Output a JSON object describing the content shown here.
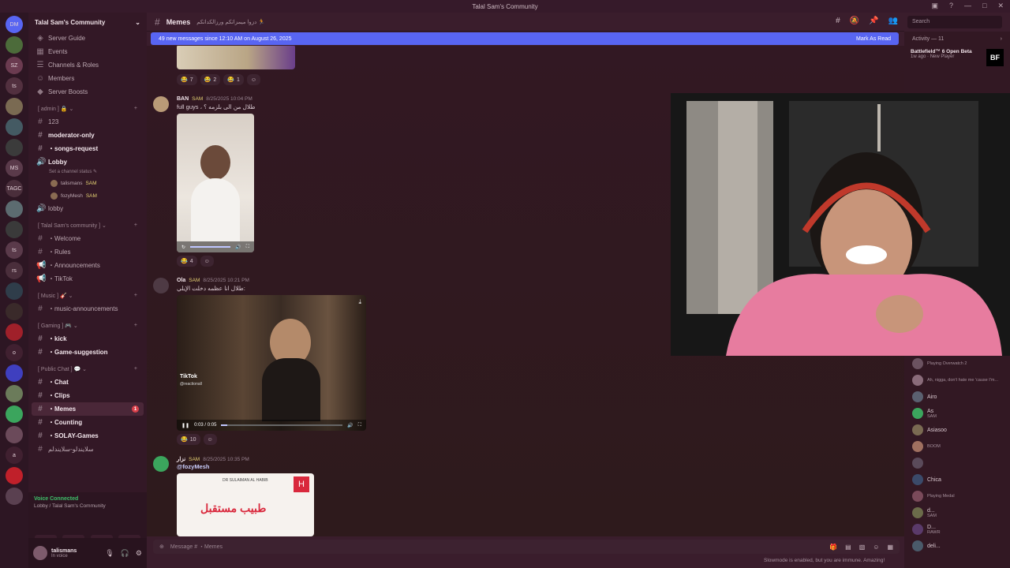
{
  "titlebar": {
    "title": "Talal Sam's Community"
  },
  "rail": {
    "servers": [
      "DM",
      "",
      "SZ",
      "ts",
      "",
      "",
      "",
      "MS",
      "TAGC",
      "",
      "",
      "ts",
      "rs",
      "",
      "",
      "",
      "o",
      "",
      "",
      "",
      "",
      "a",
      "",
      ""
    ]
  },
  "sidebar": {
    "server_name": "Talal Sam's Community",
    "top_items": [
      {
        "label": "Server Guide",
        "icon": "guide-icon"
      },
      {
        "label": "Events",
        "icon": "calendar-icon"
      },
      {
        "label": "Channels & Roles",
        "icon": "list-icon"
      },
      {
        "label": "Members",
        "icon": "people-icon"
      },
      {
        "label": "Server Boosts",
        "icon": "boost-icon"
      }
    ],
    "cat_admin": "[ admin ] 🔒 ⌄",
    "admin_channels": [
      "123",
      "moderator-only",
      "・songs-request"
    ],
    "lobby": "Lobby",
    "lobby_status": "Set a channel status ✎",
    "lobby_users": [
      {
        "name": "talismans",
        "tag": "SAM"
      },
      {
        "name": "fozyMesh",
        "tag": "SAM"
      }
    ],
    "lobby_text": "lobby",
    "cat_community": "[ Talal Sam's community ] ⌄",
    "community_channels": [
      "・Welcome",
      "・Rules",
      "・Announcements",
      "・TikTok"
    ],
    "cat_music": "[ Music ] 🎸 ⌄",
    "music_channels": [
      "・music-announcements"
    ],
    "cat_gaming": "[ Gaming ] 🎮 ⌄",
    "gaming_channels": [
      "・kick",
      "・Game-suggestion"
    ],
    "cat_public": "[ Public Chat ] 💬 ⌄",
    "public_channels": [
      "・Chat",
      "・Clips",
      "・Memes",
      "・Counting",
      "・SOLAY-Games",
      "سلايندلو-سلايندلم"
    ],
    "chat_badge": "",
    "memes_badge": "1",
    "voice_connected": "Voice Connected",
    "voice_sub": "Lobby / Talal Sam's Community",
    "user_name": "talismans",
    "user_status": "In voice"
  },
  "header": {
    "channel": "Memes",
    "topic": "دزوا ميمزاتكم ورزالكداتكم 🏃"
  },
  "search": {
    "placeholder": "Search"
  },
  "banner": {
    "text": "49 new messages since 12:10 AM on August 26, 2025",
    "action": "Mark As Read"
  },
  "messages": [
    {
      "reactions": [
        {
          "e": "😂",
          "n": "7"
        },
        {
          "e": "😂",
          "n": "2"
        },
        {
          "e": "😂",
          "n": "1"
        }
      ]
    },
    {
      "user": "BAN",
      "tag": "SAM",
      "time": "8/25/2025 10:04 PM",
      "text": "full guys ، طلال من الى بلزمه ؟",
      "reactions": [
        {
          "e": "😂",
          "n": "4"
        }
      ]
    },
    {
      "user": "Ola",
      "tag": "SAM",
      "time": "8/25/2025 10:21 PM",
      "text": "طلال انا عظمه دخلت الإيلي:",
      "video_time": "0:03 / 0:05",
      "progress": 0.05,
      "tiktok": "TikTok",
      "tiktok_handle": "@reactionall",
      "reactions": [
        {
          "e": "😂",
          "n": "10"
        }
      ]
    },
    {
      "user": "نزار",
      "tag": "SAM",
      "time": "8/25/2025 10:35 PM",
      "text": "@fozyMesh",
      "ad_title": "طبيب مستقبل",
      "ad_brand": "DR SULAIMAN AL HABIB"
    }
  ],
  "composer": {
    "placeholder": "Message # ・Memes"
  },
  "slowmode": "Slowmode is enabled, but you are immune. Amazing!",
  "members": {
    "activity_title": "Activity — 11",
    "activity": {
      "title": "Battlefield™ 6 Open Beta",
      "sub": "New Player",
      "ago": "1w ago"
    },
    "bf": "BF",
    "list": [
      {
        "name": "",
        "act": "Playing Overwatch 2"
      },
      {
        "name": "",
        "act": "Ah, nigga, don't hate me 'cause I'm..."
      },
      {
        "name": "Airo",
        "act": ""
      },
      {
        "name": "As",
        "act": "SAM"
      },
      {
        "name": "Asiasoo",
        "act": ""
      },
      {
        "name": "",
        "act": "BOOM"
      },
      {
        "name": "",
        "act": ""
      },
      {
        "name": "Chica",
        "act": ""
      },
      {
        "name": "",
        "act": "Playing Medal"
      },
      {
        "name": "d...",
        "act": "SAM"
      },
      {
        "name": "D...",
        "act": "RAWR"
      },
      {
        "name": "deli...",
        "act": ""
      }
    ]
  },
  "colors": {
    "accent": "#5865f2",
    "bg": "#3a1d2c",
    "sidebar": "#331826",
    "online": "#3fbf6a",
    "badge": "#d8404a"
  }
}
